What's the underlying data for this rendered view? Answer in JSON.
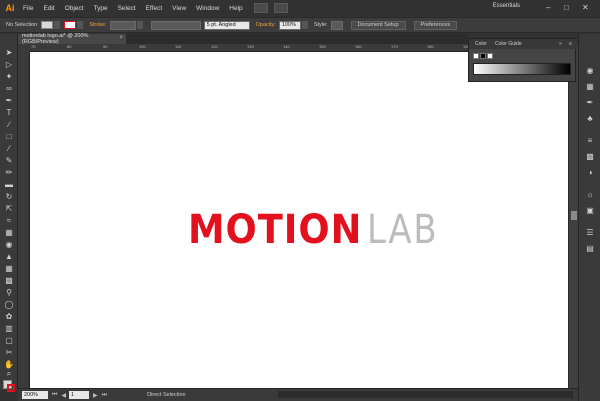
{
  "menubar": {
    "logo": "Ai",
    "items": [
      "File",
      "Edit",
      "Object",
      "Type",
      "Select",
      "Effect",
      "View",
      "Window",
      "Help"
    ],
    "workspace": "Essentials"
  },
  "controlbar": {
    "selection_label": "No Selection",
    "stroke_label": "Stroke:",
    "brush_value": "5 pt. Angled",
    "opacity_label": "Opacity:",
    "opacity_value": "100%",
    "style_label": "Style:",
    "document_setup": "Document Setup",
    "preferences": "Preferences"
  },
  "document": {
    "tab_title": "motionlab logo.ai* @ 200% (RGB/Preview)"
  },
  "ruler_ticks": [
    "70",
    "80",
    "90",
    "100",
    "110",
    "120",
    "130",
    "140",
    "150",
    "160",
    "170",
    "180",
    "190",
    "200",
    "210"
  ],
  "artwork": {
    "logo_strong": "MOTION",
    "logo_light": "LAB",
    "colors": {
      "strong": "#e3101d",
      "light": "#bcbcbc"
    }
  },
  "color_panel": {
    "tab_color": "Color",
    "tab_color_guide": "Color Guide"
  },
  "statusbar": {
    "zoom": "200%",
    "page": "1",
    "mode": "Direct Selection"
  },
  "icons": {
    "tools": [
      "selection-tool",
      "direct-selection-tool",
      "magic-wand-tool",
      "lasso-tool",
      "pen-tool",
      "type-tool",
      "line-tool",
      "rectangle-tool",
      "paintbrush-tool",
      "pencil-tool",
      "blob-brush-tool",
      "eraser-tool",
      "rotate-tool",
      "scale-tool",
      "width-tool",
      "free-transform-tool",
      "shape-builder-tool",
      "perspective-grid-tool",
      "mesh-tool",
      "gradient-tool",
      "eyedropper-tool",
      "blend-tool",
      "symbol-sprayer-tool",
      "column-graph-tool",
      "artboard-tool",
      "slice-tool",
      "hand-tool",
      "zoom-tool"
    ],
    "panels": [
      "color-panel",
      "swatches-panel",
      "brushes-panel",
      "symbols-panel",
      "stroke-panel",
      "gradient-panel",
      "transparency-panel",
      "appearance-panel",
      "graphic-styles-panel",
      "layers-panel",
      "artboards-panel"
    ]
  }
}
